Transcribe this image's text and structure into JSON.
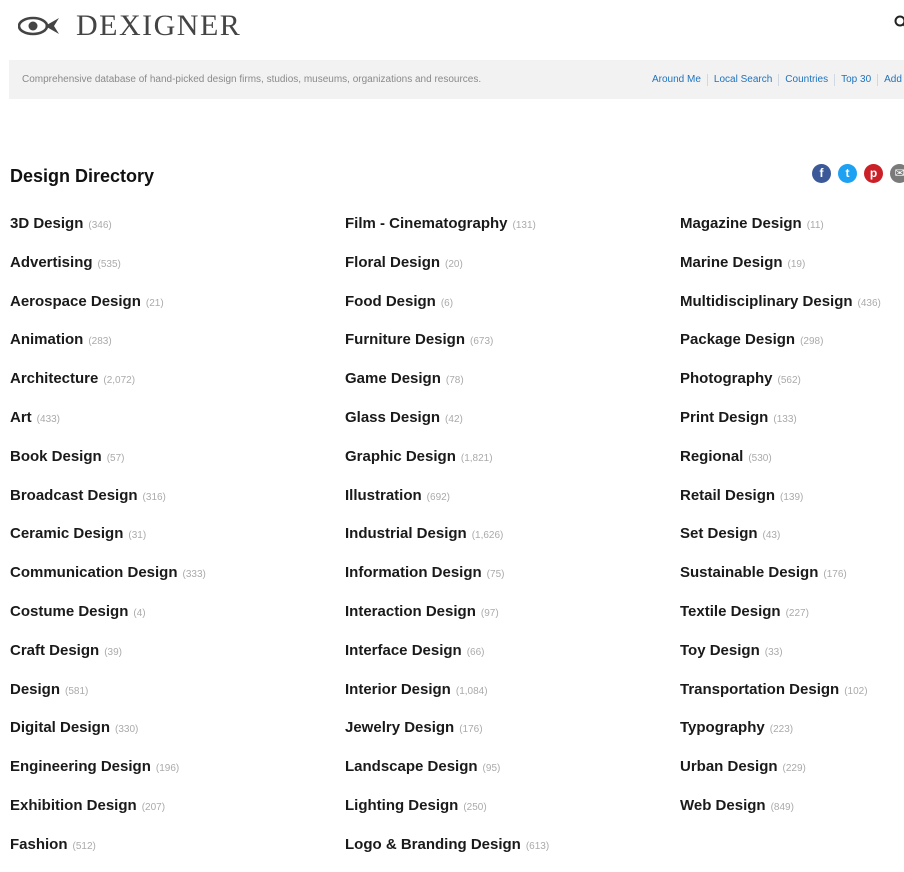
{
  "site": {
    "logo_text": "DEXIGNER",
    "tagline": "Comprehensive database of hand-picked design firms, studios, museums, organizations and resources."
  },
  "nav": {
    "items": [
      "Around Me",
      "Local Search",
      "Countries",
      "Top 30",
      "Add"
    ]
  },
  "directory": {
    "title": "Design Directory",
    "columns": [
      [
        {
          "name": "3D Design",
          "count": "(346)"
        },
        {
          "name": "Advertising",
          "count": "(535)"
        },
        {
          "name": "Aerospace Design",
          "count": "(21)"
        },
        {
          "name": "Animation",
          "count": "(283)"
        },
        {
          "name": "Architecture",
          "count": "(2,072)"
        },
        {
          "name": "Art",
          "count": "(433)"
        },
        {
          "name": "Book Design",
          "count": "(57)"
        },
        {
          "name": "Broadcast Design",
          "count": "(316)"
        },
        {
          "name": "Ceramic Design",
          "count": "(31)"
        },
        {
          "name": "Communication Design",
          "count": "(333)"
        },
        {
          "name": "Costume Design",
          "count": "(4)"
        },
        {
          "name": "Craft Design",
          "count": "(39)"
        },
        {
          "name": "Design",
          "count": "(581)"
        },
        {
          "name": "Digital Design",
          "count": "(330)"
        },
        {
          "name": "Engineering Design",
          "count": "(196)"
        },
        {
          "name": "Exhibition Design",
          "count": "(207)"
        },
        {
          "name": "Fashion",
          "count": "(512)"
        }
      ],
      [
        {
          "name": "Film - Cinematography",
          "count": "(131)"
        },
        {
          "name": "Floral Design",
          "count": "(20)"
        },
        {
          "name": "Food Design",
          "count": "(6)"
        },
        {
          "name": "Furniture Design",
          "count": "(673)"
        },
        {
          "name": "Game Design",
          "count": "(78)"
        },
        {
          "name": "Glass Design",
          "count": "(42)"
        },
        {
          "name": "Graphic Design",
          "count": "(1,821)"
        },
        {
          "name": "Illustration",
          "count": "(692)"
        },
        {
          "name": "Industrial Design",
          "count": "(1,626)"
        },
        {
          "name": "Information Design",
          "count": "(75)"
        },
        {
          "name": "Interaction Design",
          "count": "(97)"
        },
        {
          "name": "Interface Design",
          "count": "(66)"
        },
        {
          "name": "Interior Design",
          "count": "(1,084)"
        },
        {
          "name": "Jewelry Design",
          "count": "(176)"
        },
        {
          "name": "Landscape Design",
          "count": "(95)"
        },
        {
          "name": "Lighting Design",
          "count": "(250)"
        },
        {
          "name": "Logo & Branding Design",
          "count": "(613)"
        }
      ],
      [
        {
          "name": "Magazine Design",
          "count": "(11)"
        },
        {
          "name": "Marine Design",
          "count": "(19)"
        },
        {
          "name": "Multidisciplinary Design",
          "count": "(436)"
        },
        {
          "name": "Package Design",
          "count": "(298)"
        },
        {
          "name": "Photography",
          "count": "(562)"
        },
        {
          "name": "Print Design",
          "count": "(133)"
        },
        {
          "name": "Regional",
          "count": "(530)"
        },
        {
          "name": "Retail Design",
          "count": "(139)"
        },
        {
          "name": "Set Design",
          "count": "(43)"
        },
        {
          "name": "Sustainable Design",
          "count": "(176)"
        },
        {
          "name": "Textile Design",
          "count": "(227)"
        },
        {
          "name": "Toy Design",
          "count": "(33)"
        },
        {
          "name": "Transportation Design",
          "count": "(102)"
        },
        {
          "name": "Typography",
          "count": "(223)"
        },
        {
          "name": "Urban Design",
          "count": "(229)"
        },
        {
          "name": "Web Design",
          "count": "(849)"
        }
      ]
    ]
  },
  "share": {
    "icons": [
      "facebook-icon",
      "twitter-icon",
      "pinterest-icon",
      "email-icon"
    ],
    "glyphs": [
      "f",
      "t",
      "p",
      "✉"
    ],
    "colors": [
      "#3b5998",
      "#1da1f2",
      "#cb2027",
      "#7a7a7a"
    ]
  },
  "colors": {
    "link": "#1e73be",
    "tagbar_bg": "#f2f2f2",
    "count": "#aaaaaa"
  }
}
